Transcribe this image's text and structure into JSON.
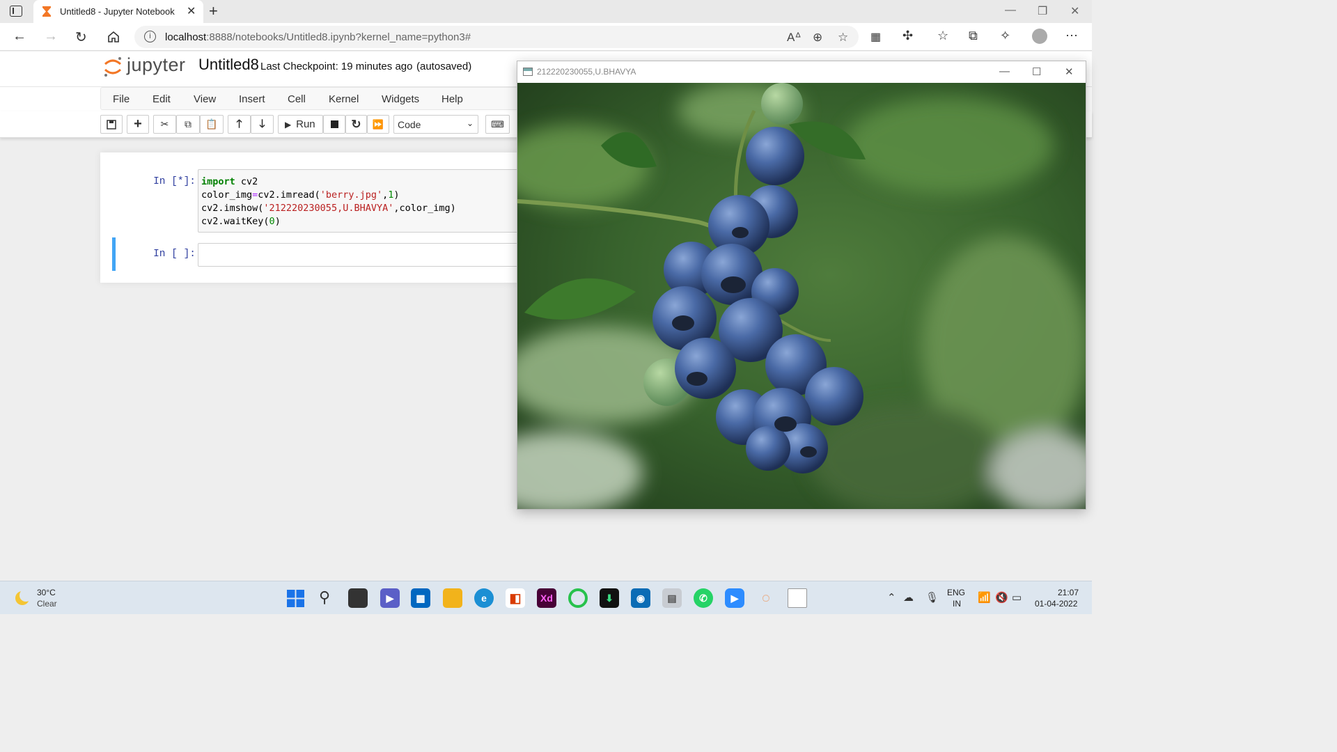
{
  "browser": {
    "tab_title": "Untitled8 - Jupyter Notebook",
    "url_host": "localhost",
    "url_rest": ":8888/notebooks/Untitled8.ipynb?kernel_name=python3#"
  },
  "jupyter": {
    "logo_text": "jupyter",
    "notebook_name": "Untitled8",
    "checkpoint": "Last Checkpoint: 19 minutes ago",
    "autosave_status": "(autosaved)",
    "menu": [
      "File",
      "Edit",
      "View",
      "Insert",
      "Cell",
      "Kernel",
      "Widgets",
      "Help"
    ],
    "toolbar": {
      "run_label": "Run",
      "cell_type": "Code"
    },
    "cells": [
      {
        "prompt": "In [*]:",
        "code": [
          "import cv2",
          "color_img=cv2.imread('berry.jpg',1)",
          "cv2.imshow('212220230055,U.BHAVYA',color_img)",
          "cv2.waitKey(0)"
        ]
      },
      {
        "prompt": "In [ ]:",
        "code": []
      }
    ]
  },
  "cv_window": {
    "title": "212220230055,U.BHAVYA",
    "image_subject": "blueberries-cluster"
  },
  "taskbar": {
    "weather_temp": "30°C",
    "weather_condition": "Clear",
    "language_top": "ENG",
    "language_bottom": "IN",
    "time": "21:07",
    "date": "01-04-2022"
  },
  "colors": {
    "jupyter_orange": "#f37726",
    "prompt_blue": "#303f9f",
    "selected_cell": "#42a5f5",
    "keyword_green": "#008000",
    "string_red": "#ba2121"
  }
}
